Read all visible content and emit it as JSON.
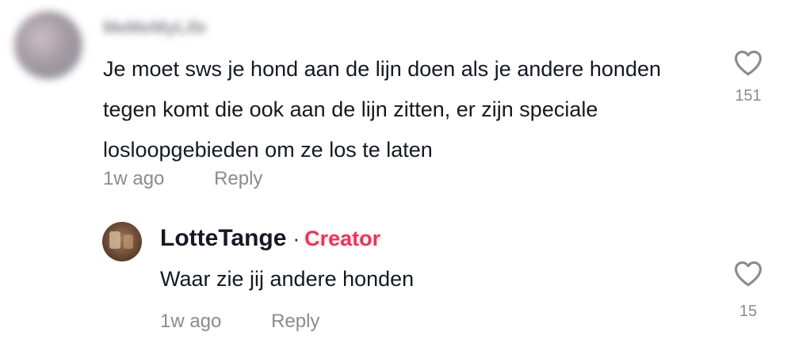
{
  "top_comment": {
    "username": "MeMeMyLife",
    "text": "Je moet sws je hond aan de lijn doen als je andere honden tegen komt die ook aan de lijn zitten, er zijn speciale losloopgebieden om ze los te laten",
    "timestamp": "1w ago",
    "reply_label": "Reply",
    "like_icon": "heart-outline",
    "like_count": "151"
  },
  "reply_comment": {
    "username": "LotteTange",
    "separator": "·",
    "badge": "Creator",
    "text": "Waar zie jij andere honden",
    "timestamp": "1w ago",
    "reply_label": "Reply",
    "like_icon": "heart-outline",
    "like_count": "15"
  },
  "colors": {
    "text": "#161823",
    "secondary": "#8a8b91",
    "creator_badge": "#fe2c55",
    "background": "#ffffff"
  }
}
